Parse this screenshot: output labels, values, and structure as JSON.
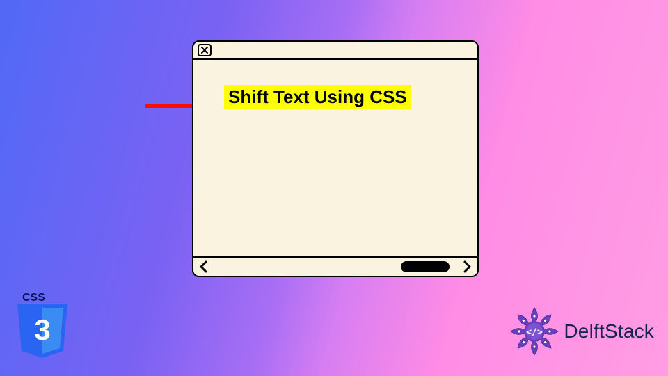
{
  "headline_text": "Shift Text Using CSS",
  "css3_badge": {
    "label": "CSS",
    "version": "3"
  },
  "brand": {
    "name": "DelftStack"
  },
  "icons": {
    "close": "close-icon",
    "chev_left": "chevron-left-icon",
    "chev_right": "chevron-right-icon",
    "pointer": "arrow-right-icon",
    "css3": "css3-badge-icon",
    "mandala": "mandala-icon"
  },
  "colors": {
    "highlight_bg": "#ffff00",
    "window_bg": "#faf3df",
    "arrow_red": "#ff0b00",
    "delft_purple": "#6a3fbf",
    "delft_text": "#1b2350",
    "css3_blue": "#2965f1"
  }
}
